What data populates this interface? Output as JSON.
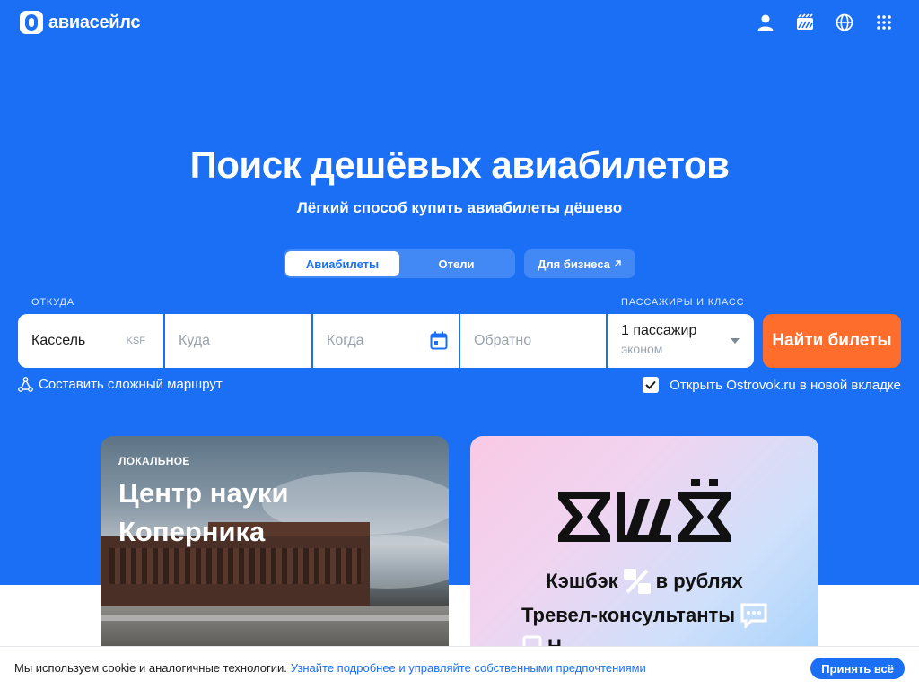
{
  "header": {
    "logo_text": "авиасейлс",
    "icons": [
      "user-icon",
      "tickets-icon",
      "globe-icon",
      "apps-grid-icon"
    ]
  },
  "hero": {
    "title": "Поиск дешёвых авиабилетов",
    "subtitle": "Лёгкий способ купить авиабилеты дёшево"
  },
  "tabs": {
    "items": [
      {
        "label": "Авиабилеты",
        "active": true
      },
      {
        "label": "Отели",
        "active": false
      }
    ],
    "business_label": "Для бизнеса"
  },
  "search": {
    "from_label": "ОТКУДА",
    "passengers_label": "ПАССАЖИРЫ И КЛАСС",
    "from_value": "Кассель",
    "from_code": "KSF",
    "to_placeholder": "Куда",
    "date_placeholder": "Когда",
    "return_placeholder": "Обратно",
    "passengers_value": "1 пассажир",
    "class_value": "эконом",
    "button_label": "Найти билеты"
  },
  "options": {
    "complex_route_label": "Составить сложный маршрут",
    "ostrovok_label": "Открыть Ostrovok.ru в новой вкладке",
    "ostrovok_checked": true
  },
  "cards": {
    "left": {
      "tag": "ЛОКАЛЬНОЕ",
      "title": "Центр науки Коперника"
    },
    "right": {
      "line1": "Кэшбэк",
      "line1_suffix": "в рублях",
      "line2": "Тревел-консультанты",
      "line3": "Н"
    }
  },
  "cookie": {
    "text": "Мы используем cookie и аналогичные технологии.",
    "link": "Узнайте подробнее и управляйте собственными предпочтениями",
    "accept_label": "Принять всё"
  },
  "colors": {
    "brand_blue": "#1a6ff5",
    "search_orange": "#ff6d2c"
  }
}
